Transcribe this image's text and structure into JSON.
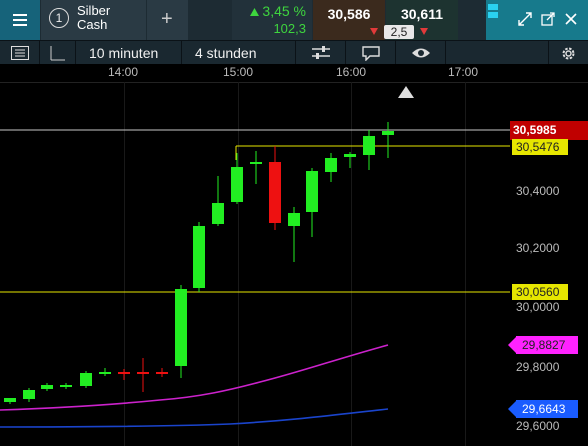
{
  "instrument": {
    "number": "1",
    "name_line1": "Silber",
    "name_line2": "Cash"
  },
  "quote": {
    "change_pct": "3,45 %",
    "change_pts": "102,3",
    "bid": "30,586",
    "ask": "30,611",
    "spread": "2,5"
  },
  "toolbar": {
    "interval": "10 minuten",
    "range": "4 stunden"
  },
  "time_axis": [
    "14:00",
    "15:00",
    "16:00",
    "17:00"
  ],
  "price_axis": [
    "30,4000",
    "30,2000",
    "30,0000",
    "29,8000",
    "29,6000"
  ],
  "badges": {
    "current": "30,5985",
    "line_upper": "30,5476",
    "line_lower": "30,0560",
    "ma_magenta": "29,8827",
    "ma_blue": "29,6643"
  },
  "colors": {
    "up": "#22ee22",
    "down": "#ee1111",
    "hline": "#e6e600",
    "current": "#cc0000",
    "ma1": "#cc22cc",
    "ma2": "#1a44cc",
    "accent": "#16637a"
  }
}
